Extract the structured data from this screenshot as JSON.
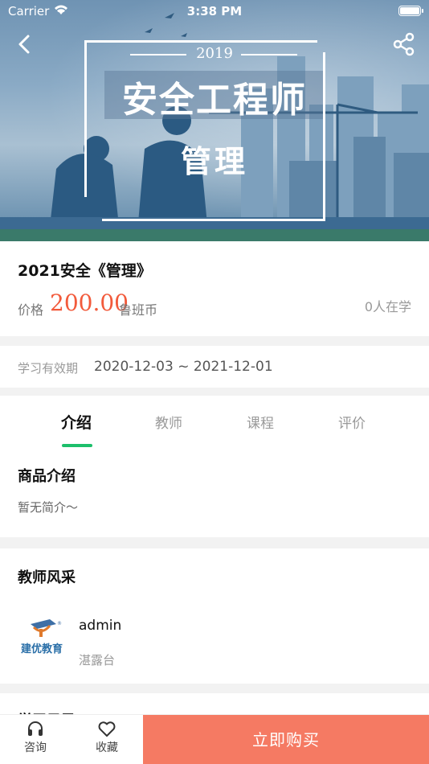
{
  "status_bar": {
    "carrier": "Carrier",
    "time": "3:38 PM"
  },
  "banner": {
    "year": "2019",
    "title": "安全工程师",
    "subtitle": "管理"
  },
  "product": {
    "title": "2021安全《管理》",
    "price_label": "价格",
    "price_value": "200.00",
    "price_unit": "鲁班币",
    "learners": "0人在学"
  },
  "validity": {
    "label": "学习有效期",
    "value": "2020-12-03 ~ 2021-12-01"
  },
  "tabs": [
    {
      "label": "介绍",
      "active": true
    },
    {
      "label": "教师",
      "active": false
    },
    {
      "label": "课程",
      "active": false
    },
    {
      "label": "评价",
      "active": false
    }
  ],
  "intro": {
    "title": "商品介绍",
    "body": "暂无简介～"
  },
  "teachers": {
    "title": "教师风采",
    "items": [
      {
        "name": "admin",
        "org": "湛露台",
        "logo_text": "建优教育"
      }
    ]
  },
  "next_section": {
    "title": "学习目录"
  },
  "bottom_bar": {
    "consult_label": "咨询",
    "favorite_label": "收藏",
    "buy_label": "立即购买"
  },
  "colors": {
    "accent_green": "#1cbf6b",
    "price_red": "#f25a3b",
    "buy_button": "#f57a63"
  }
}
